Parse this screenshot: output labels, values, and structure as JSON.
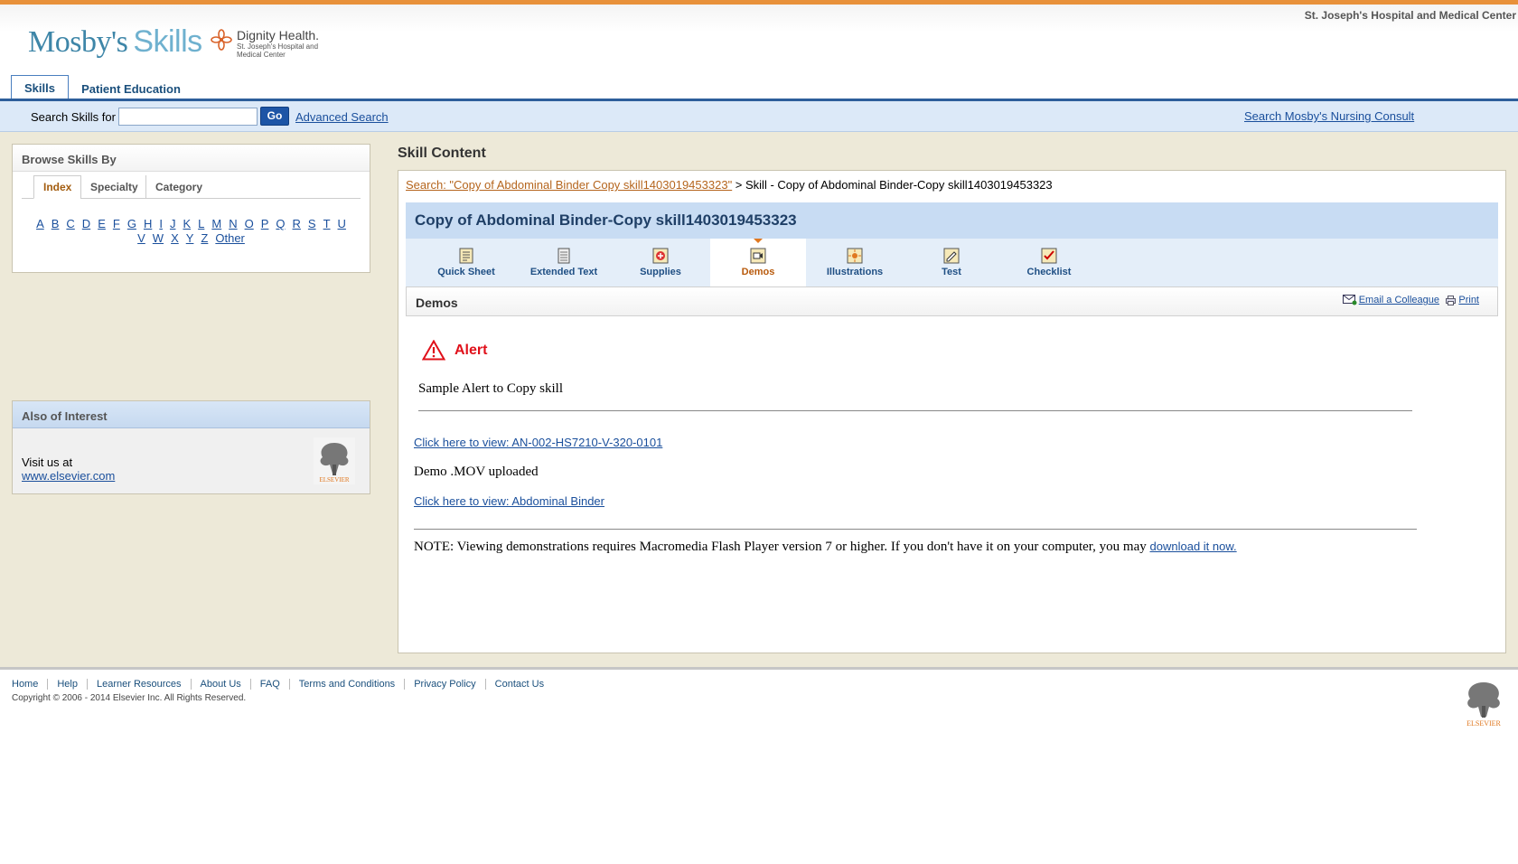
{
  "header": {
    "hospital_name": "St. Joseph's Hospital and Medical Center",
    "logo_brand": "Mosby's",
    "logo_product": "Skills",
    "partner_name": "Dignity Health.",
    "partner_sub1": "St. Joseph's Hospital and",
    "partner_sub2": "Medical Center"
  },
  "tabs": {
    "skills": "Skills",
    "patient_education": "Patient Education"
  },
  "search": {
    "label": "Search Skills for",
    "placeholder": "",
    "go": "Go",
    "advanced": "Advanced Search",
    "consult": "Search Mosby's Nursing Consult"
  },
  "browse": {
    "title": "Browse Skills By",
    "tabs": [
      "Index",
      "Specialty",
      "Category"
    ],
    "letters_row1": [
      "A",
      "B",
      "C",
      "D",
      "E",
      "F",
      "G",
      "H",
      "I",
      "J",
      "K",
      "L",
      "M",
      "N",
      "O",
      "P",
      "Q",
      "R",
      "S",
      "T",
      "U"
    ],
    "letters_row2": [
      "V",
      "W",
      "X",
      "Y",
      "Z",
      "Other"
    ]
  },
  "interest": {
    "title": "Also of Interest",
    "visit": "Visit us at",
    "url": "www.elsevier.com",
    "logo_word": "ELSEVIER"
  },
  "content": {
    "title": "Skill Content",
    "breadcrumb_link": "Search: \"Copy of Abdominal Binder Copy skill1403019453323\"",
    "breadcrumb_rest": " > Skill - Copy of Abdominal Binder-Copy skill1403019453323",
    "skill_title": "Copy of Abdominal Binder-Copy skill1403019453323",
    "skill_tabs": [
      "Quick Sheet",
      "Extended Text",
      "Supplies",
      "Demos",
      "Illustrations",
      "Test",
      "Checklist"
    ],
    "active_tab": "Demos",
    "section_title": "Demos",
    "email": "Email a Colleague",
    "print": "Print",
    "alert_title": "Alert",
    "alert_text": "Sample Alert to Copy skill",
    "link1": "Click here to view: AN-002-HS7210-V-320-0101",
    "demo_text": "Demo .MOV uploaded",
    "link2": "Click here to view: Abdominal Binder",
    "note_text": "NOTE: Viewing demonstrations requires Macromedia Flash Player version 7 or higher. If you don't have it on your computer, you may ",
    "note_link": "download it now."
  },
  "footer": {
    "links": [
      "Home",
      "Help",
      "Learner Resources",
      "About Us",
      "FAQ",
      "Terms and Conditions",
      "Privacy Policy",
      "Contact Us"
    ],
    "copyright": "Copyright © 2006 - 2014 Elsevier Inc. All Rights Reserved.",
    "logo_word": "ELSEVIER"
  },
  "colors": {
    "accent_orange": "#e8913a",
    "nav_blue": "#2d5e9b",
    "alert_red": "#e0101a",
    "sand_bg": "#ede9d8"
  }
}
